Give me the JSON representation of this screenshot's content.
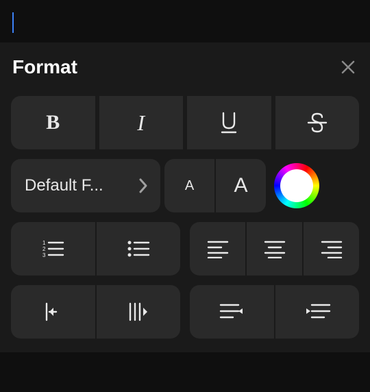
{
  "panel": {
    "title": "Format"
  },
  "textStyle": {
    "bold": "B",
    "italic": "I",
    "underline": "U",
    "strikethrough": "S"
  },
  "font": {
    "selector_label": "Default F..."
  },
  "textSize": {
    "small": "A",
    "large": "A"
  }
}
